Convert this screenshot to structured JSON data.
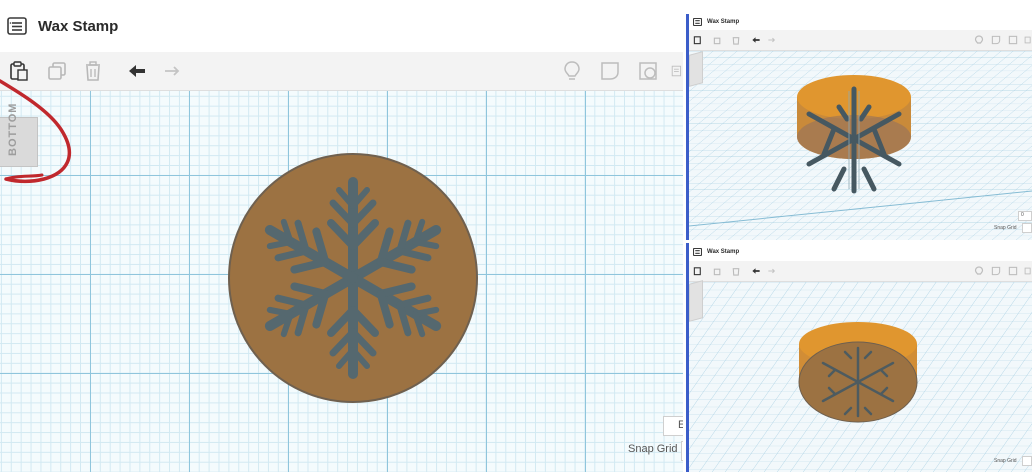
{
  "main": {
    "title": "Wax Stamp",
    "view_cube_label": "BOTTOM",
    "snap_grid_label": "Snap Grid",
    "edit_grid_label": "E"
  },
  "top_right": {
    "title": "Wax Stamp",
    "snap_grid_label": "Snap Grid",
    "value_label": "0"
  },
  "bottom_right": {
    "title": "Wax Stamp",
    "snap_grid_label": "Snap Grid"
  },
  "colors": {
    "stamp_fill": "#9c7242",
    "stamp_top": "#e0962f",
    "snowflake": "#55686f",
    "accent": "#3b5dc9",
    "annotation": "#c0282d",
    "grid_major": "#8fc5dc",
    "grid_minor": "#d2e9f2"
  },
  "icons": [
    "menu-icon",
    "paste-icon",
    "duplicate-icon",
    "delete-icon",
    "undo-icon",
    "redo-icon",
    "light-bulb-icon",
    "shape-outline-icon",
    "group-icon"
  ]
}
